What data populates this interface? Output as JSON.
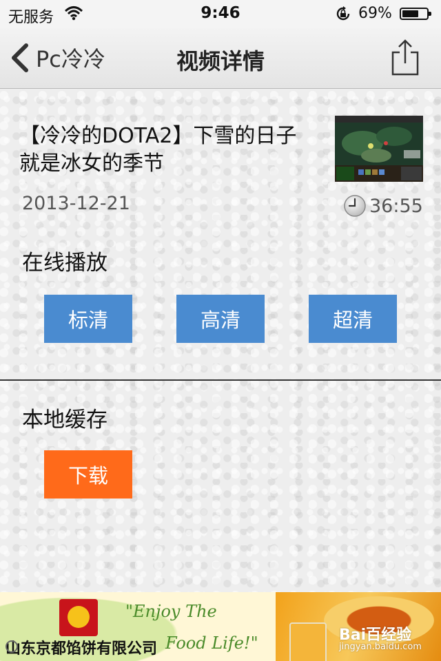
{
  "status_bar": {
    "carrier": "无服务",
    "time": "9:46",
    "battery_percent": "69%",
    "battery_level": 0.69
  },
  "nav_bar": {
    "back_label": "Pc冷冷",
    "title": "视频详情"
  },
  "video": {
    "title": "【冷冷的DOTA2】下雪的日子就是冰女的季节",
    "date": "2013-12-21",
    "duration": "36:55"
  },
  "online_play": {
    "label": "在线播放",
    "buttons": [
      "标清",
      "高清",
      "超清"
    ]
  },
  "local_cache": {
    "label": "本地缓存",
    "download_label": "下载"
  },
  "ad": {
    "slogan_line1": "\"Enjoy The",
    "slogan_line2": "Food Life!\"",
    "company": "山东京都馅饼有限公司",
    "watermark": "Bai百经验",
    "watermark_url": "jingyan.baidu.com"
  },
  "colors": {
    "button_blue": "#4a8bd0",
    "button_orange": "#ff6a1a"
  }
}
